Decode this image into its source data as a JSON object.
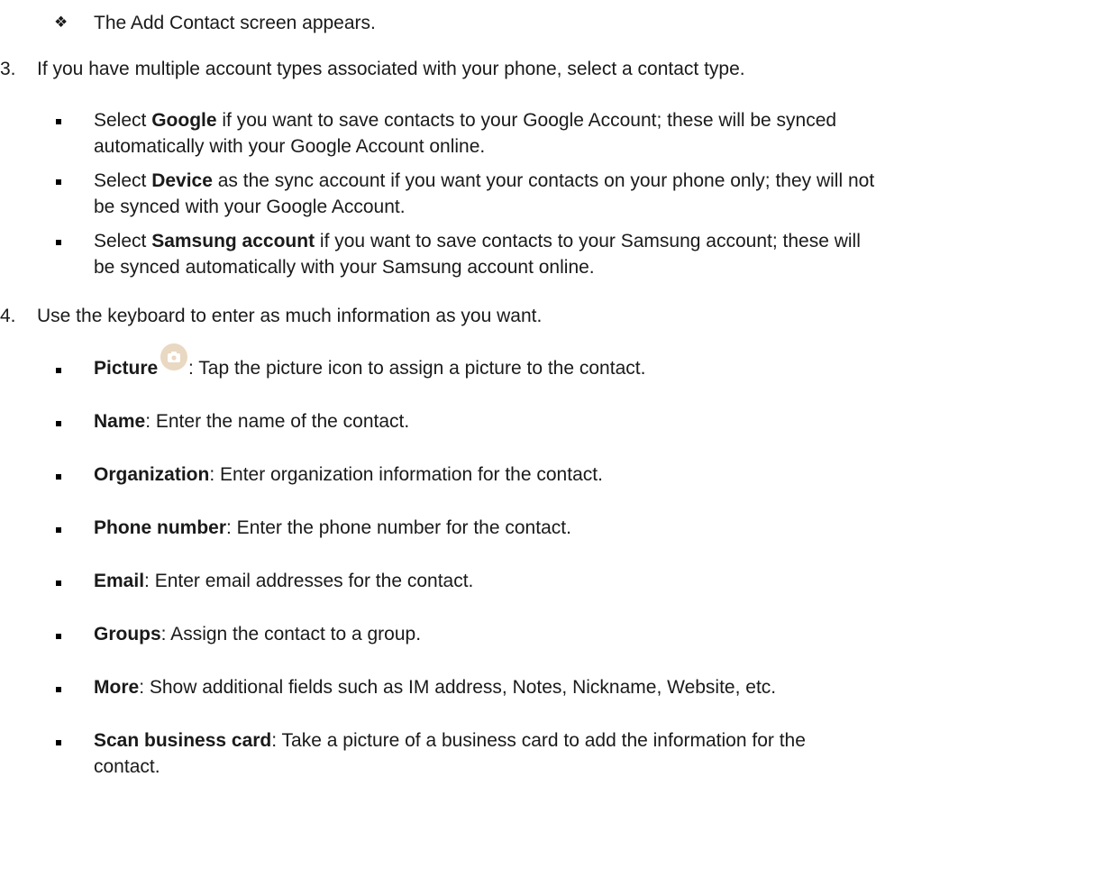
{
  "intro_bullet": {
    "marker": "❖",
    "text": "The Add Contact screen appears."
  },
  "steps": [
    {
      "number": "3.",
      "text": "If you have multiple account types associated with your phone, select a contact type.",
      "bullets": [
        {
          "bold": "Google",
          "prefix": "Select ",
          "line1_rest": " if you want to save contacts to your Google Account; these will be synced",
          "line2": "automatically with your Google Account online."
        },
        {
          "bold": "Device",
          "prefix": "Select ",
          "line1_rest": " as the sync account if you want your contacts on your phone only; they will not",
          "line2": "be synced with your Google Account."
        },
        {
          "bold": "Samsung account",
          "prefix": "Select ",
          "line1_rest": " if you want to save contacts to your Samsung account; these will",
          "line2": "be synced automatically with your Samsung account online."
        }
      ]
    },
    {
      "number": "4.",
      "text": "Use the keyboard to enter as much information as you want.",
      "bullets": [
        {
          "term": "Picture",
          "desc": ": Tap the picture icon to assign a picture to the contact.",
          "icon": "camera-icon"
        },
        {
          "term": "Name",
          "desc": ": Enter the name of the contact."
        },
        {
          "term": "Organization",
          "desc": ": Enter organization information for the contact."
        },
        {
          "term": "Phone number",
          "desc": ": Enter the phone number for the contact."
        },
        {
          "term": "Email",
          "desc": ": Enter email addresses for the contact."
        },
        {
          "term": "Groups",
          "desc": ": Assign the contact to a group."
        },
        {
          "term": "More",
          "desc": ": Show additional fields such as IM address, Notes, Nickname, Website, etc."
        },
        {
          "term": "Scan business card",
          "desc": ": Take a picture of a business card to add the information for the",
          "desc_line2": "contact."
        }
      ]
    }
  ]
}
